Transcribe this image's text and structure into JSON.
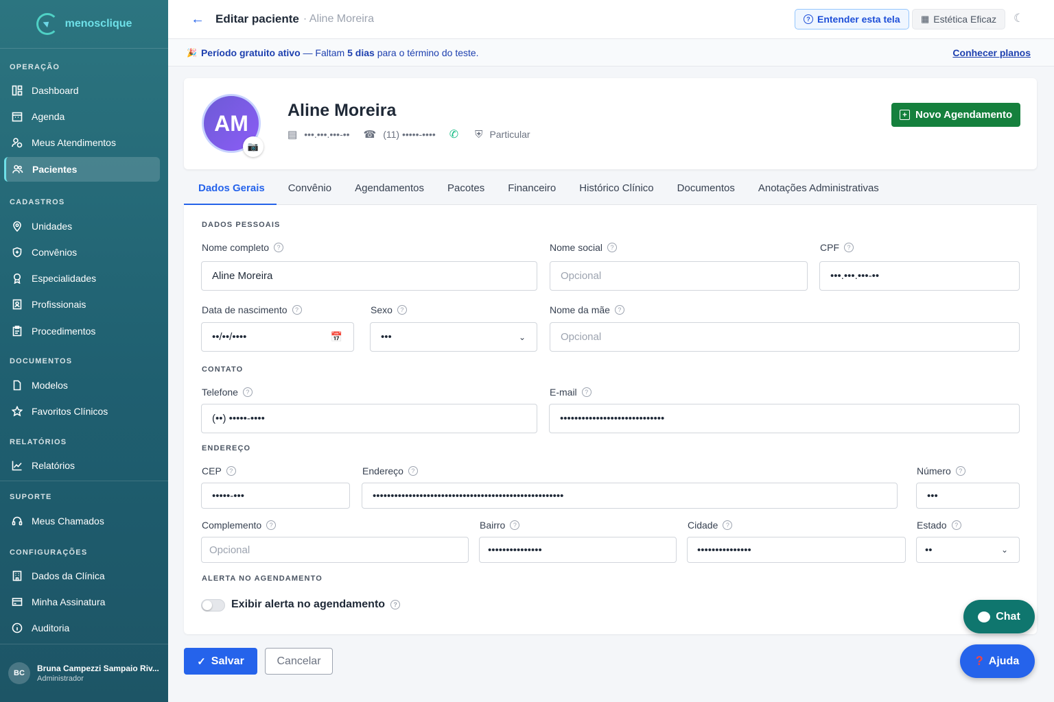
{
  "app": {
    "logo_text": "menosclique"
  },
  "sidebar": {
    "sections": [
      {
        "title": "OPERAÇÃO",
        "items": [
          {
            "label": "Dashboard",
            "icon": "dashboard-icon",
            "active": false
          },
          {
            "label": "Agenda",
            "icon": "calendar-icon",
            "active": false
          },
          {
            "label": "Meus Atendimentos",
            "icon": "user-clock-icon",
            "active": false
          },
          {
            "label": "Pacientes",
            "icon": "users-icon",
            "active": true
          }
        ]
      },
      {
        "title": "CADASTROS",
        "items": [
          {
            "label": "Unidades",
            "icon": "map-pin-icon"
          },
          {
            "label": "Convênios",
            "icon": "shield-icon"
          },
          {
            "label": "Especialidades",
            "icon": "award-icon"
          },
          {
            "label": "Profissionais",
            "icon": "id-badge-icon"
          },
          {
            "label": "Procedimentos",
            "icon": "clipboard-icon"
          }
        ]
      },
      {
        "title": "DOCUMENTOS",
        "items": [
          {
            "label": "Modelos",
            "icon": "file-icon"
          },
          {
            "label": "Favoritos Clínicos",
            "icon": "star-icon"
          }
        ]
      },
      {
        "title": "RELATÓRIOS",
        "items": [
          {
            "label": "Relatórios",
            "icon": "chart-line-icon"
          }
        ]
      },
      {
        "title": "SUPORTE",
        "items": [
          {
            "label": "Meus Chamados",
            "icon": "headset-icon"
          }
        ]
      },
      {
        "title": "CONFIGURAÇÕES",
        "items": [
          {
            "label": "Dados da Clínica",
            "icon": "building-icon"
          },
          {
            "label": "Minha Assinatura",
            "icon": "credit-card-icon"
          },
          {
            "label": "Auditoria",
            "icon": "info-icon"
          }
        ]
      }
    ],
    "user": {
      "initials": "BC",
      "name": "Bruna Campezzi Sampaio Riv...",
      "role": "Administrador"
    }
  },
  "header": {
    "title": "Editar paciente",
    "subtitle": "· Aline Moreira",
    "help_label": "Entender esta tela",
    "clinic_label": "Estética Eficaz"
  },
  "banner": {
    "strong": "Período gratuito ativo",
    "text_a": " — Faltam ",
    "days": "5 dias",
    "text_b": " para o término do teste.",
    "link": "Conhecer planos"
  },
  "patient": {
    "initials": "AM",
    "name": "Aline Moreira",
    "cpf_masked": "•••.•••.•••-••",
    "phone_masked": "(11) •••••-••••",
    "plan": "Particular",
    "new_appointment_label": "Novo Agendamento"
  },
  "tabs": [
    "Dados Gerais",
    "Convênio",
    "Agendamentos",
    "Pacotes",
    "Financeiro",
    "Histórico Clínico",
    "Documentos",
    "Anotações Administrativas"
  ],
  "form": {
    "sections": {
      "personal": "DADOS PESSOAIS",
      "contact": "CONTATO",
      "address": "ENDEREÇO",
      "alert": "ALERTA NO AGENDAMENTO"
    },
    "fields": {
      "nome_completo": {
        "label": "Nome completo",
        "value": "Aline Moreira"
      },
      "nome_social": {
        "label": "Nome social",
        "placeholder": "Opcional"
      },
      "cpf": {
        "label": "CPF",
        "value": "•••.•••.•••-••"
      },
      "data_nascimento": {
        "label": "Data de nascimento",
        "value": "••/••/••••"
      },
      "sexo": {
        "label": "Sexo",
        "value": "•••"
      },
      "nome_mae": {
        "label": "Nome da mãe",
        "placeholder": "Opcional"
      },
      "telefone": {
        "label": "Telefone",
        "value": "(••) •••••-••••"
      },
      "email": {
        "label": "E-mail",
        "value": "•••••••••••••••••••••••••••••"
      },
      "cep": {
        "label": "CEP",
        "value": "•••••-•••"
      },
      "endereco": {
        "label": "Endereço",
        "value": "•••••••••••••••••••••••••••••••••••••••••••••••••••••"
      },
      "numero": {
        "label": "Número",
        "value": "•••"
      },
      "complemento": {
        "label": "Complemento",
        "placeholder": "Opcional"
      },
      "bairro": {
        "label": "Bairro",
        "value": "•••••••••••••••"
      },
      "cidade": {
        "label": "Cidade",
        "value": "•••••••••••••••"
      },
      "estado": {
        "label": "Estado",
        "value": "••"
      }
    },
    "alert_toggle_label": "Exibir alerta no agendamento",
    "alert_toggle_on": false
  },
  "actions": {
    "save_label": "Salvar",
    "cancel_label": "Cancelar"
  },
  "floating": {
    "chat_label": "Chat",
    "help_label": "Ajuda"
  },
  "colors": {
    "sidebar": "#1f5f70",
    "primary": "#2563eb",
    "success": "#15803d",
    "chat": "#0f766e"
  }
}
